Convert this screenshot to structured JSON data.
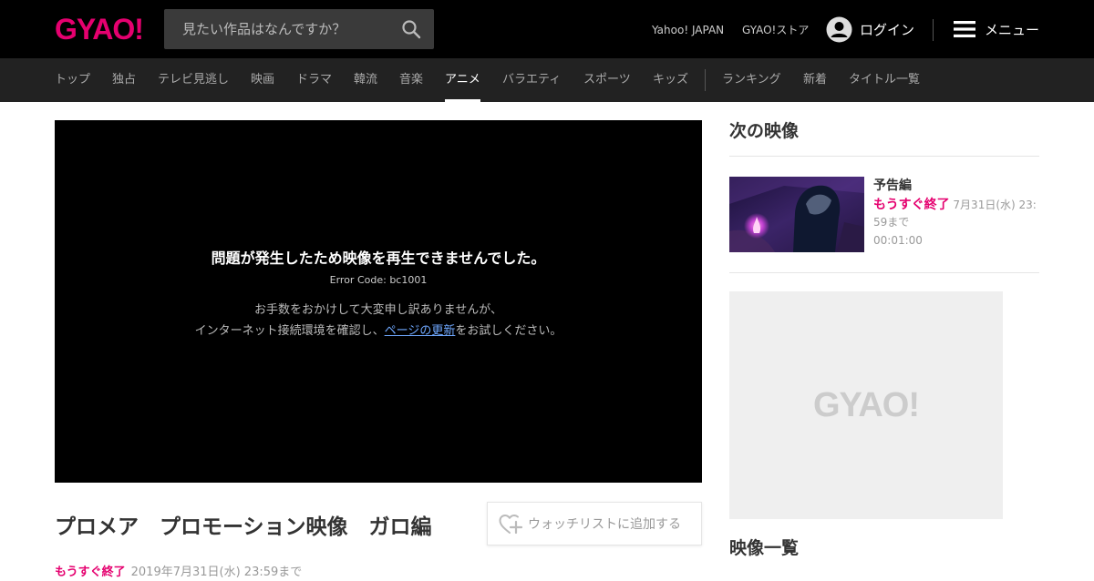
{
  "header": {
    "logo": "GYAO!",
    "search_placeholder": "見たい作品はなんですか？",
    "links": [
      "Yahoo! JAPAN",
      "GYAO!ストア"
    ],
    "login_label": "ログイン",
    "menu_label": "メニュー"
  },
  "nav": {
    "items": [
      "トップ",
      "独占",
      "テレビ見逃し",
      "映画",
      "ドラマ",
      "韓流",
      "音楽",
      "アニメ",
      "バラエティ",
      "スポーツ",
      "キッズ",
      "ランキング",
      "新着",
      "タイトル一覧"
    ],
    "active": "アニメ"
  },
  "player": {
    "error_message": "問題が発生したため映像を再生できませんでした。",
    "error_code": "Error Code: bc1001",
    "apology_line1": "お手数をおかけして大変申し訳ありませんが、",
    "apology_line2_before": "インターネット接続環境を確認し、",
    "refresh_link": "ページの更新",
    "apology_line2_after": "をお試しください。"
  },
  "video": {
    "title": "プロメア　プロモーション映像　ガロ編",
    "watchlist_label": "ウォッチリストに追加する",
    "ending_soon": "もうすぐ終了",
    "deadline": "2019年7月31日(水) 23:59まで"
  },
  "sidebar": {
    "next_heading": "次の映像",
    "next_item": {
      "title": "予告編",
      "ending_soon": "もうすぐ終了",
      "deadline": "7月31日(水) 23:59まで",
      "duration": "00:01:00"
    },
    "ad_logo": "GYAO!",
    "list_heading": "映像一覧"
  },
  "colors": {
    "brand": "#e5006f",
    "header_bg": "#000000",
    "nav_bg": "#222222",
    "link_blue": "#6fa8ff"
  }
}
